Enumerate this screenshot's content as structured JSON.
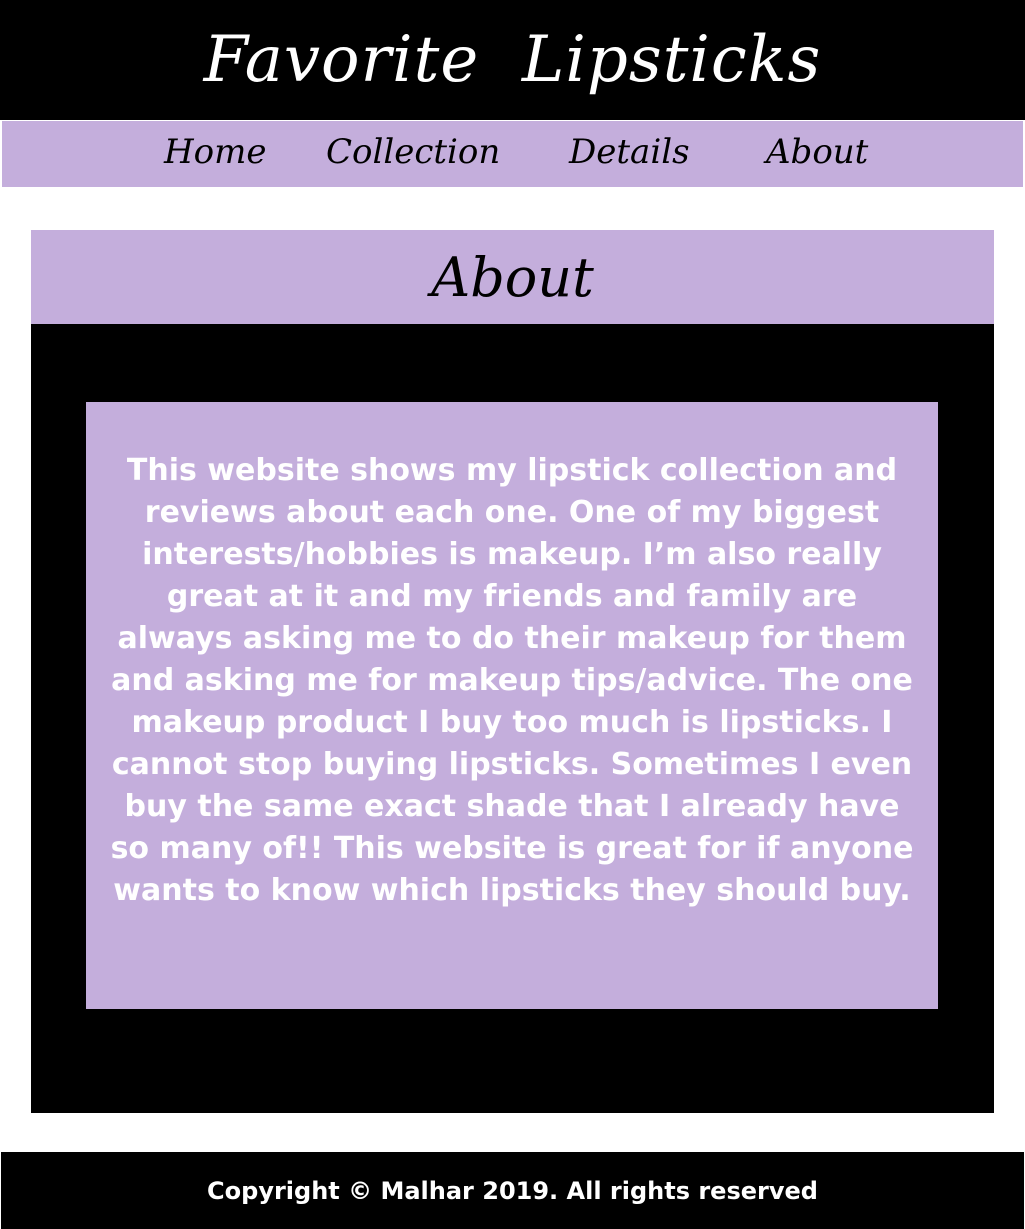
{
  "header": {
    "title": "Favorite  Lipsticks"
  },
  "nav": {
    "items": [
      {
        "label": "Home"
      },
      {
        "label": "Collection"
      },
      {
        "label": "Details"
      },
      {
        "label": "About"
      }
    ]
  },
  "about": {
    "heading": "About",
    "body": "This website shows my lipstick collection and reviews about each one. One of my biggest interests/hobbies is makeup. I’m also really great at it and my friends and family are always asking me to do their makeup for them and asking me for makeup tips/advice. The one makeup product I buy too much is lipsticks. I cannot stop buying lipsticks. Sometimes I even buy the same exact shade that I already have so many of!! This website is great for if anyone wants to know which lipsticks they should buy."
  },
  "footer": {
    "text": "Copyright © Malhar 2019. All rights reserved"
  },
  "colors": {
    "black": "#000000",
    "lavender": "#c4aedc",
    "white": "#ffffff"
  }
}
